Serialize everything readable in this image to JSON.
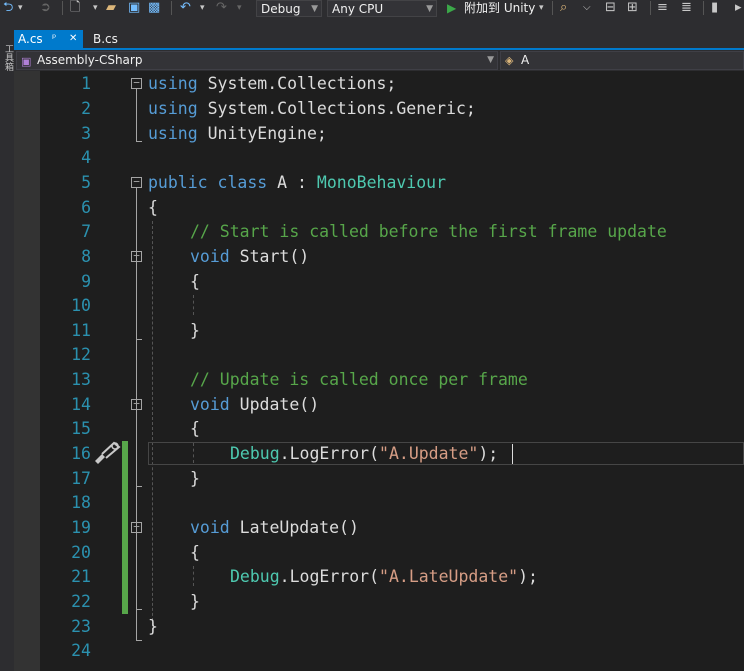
{
  "toolbar": {
    "config": "Debug",
    "platform": "Any CPU",
    "attach_label": "附加到 Unity"
  },
  "side_strip": {
    "label": "工具箱"
  },
  "tabs": [
    {
      "label": "A.cs",
      "pin": "ᵖ",
      "close": "✕"
    },
    {
      "label": "B.cs"
    }
  ],
  "navbar": {
    "project": "Assembly-CSharp",
    "type": "A"
  },
  "colors": {
    "keyword": "#569cd6",
    "type": "#4ec9b0",
    "comment": "#57a64a",
    "string": "#d69d85",
    "line_number": "#2b91af",
    "accent": "#007acc"
  },
  "code": {
    "line_numbers": [
      "1",
      "2",
      "3",
      "4",
      "5",
      "6",
      "7",
      "8",
      "9",
      "10",
      "11",
      "12",
      "13",
      "14",
      "15",
      "16",
      "17",
      "18",
      "19",
      "20",
      "21",
      "22",
      "23",
      "24"
    ],
    "l1": {
      "kw": "using",
      "rest": " System.Collections;"
    },
    "l2": {
      "kw": "using",
      "rest": " System.Collections.Generic;"
    },
    "l3": {
      "kw": "using",
      "rest": " UnityEngine;"
    },
    "l5": {
      "kw1": "public",
      "kw2": " class",
      "name": " A :",
      "base": " MonoBehaviour"
    },
    "l6": "{",
    "l7": "// Start is called before the first frame update",
    "l8": {
      "kw": "void",
      "name": " Start()"
    },
    "l9": "{",
    "l11": "}",
    "l13": "// Update is called once per frame",
    "l14": {
      "kw": "void",
      "name": " Update()"
    },
    "l15": "{",
    "l16": {
      "cls": "Debug",
      "mid": ".LogError(",
      "str": "\"A.Update\"",
      "end": ");"
    },
    "l17": "}",
    "l19": {
      "kw": "void",
      "name": " LateUpdate()"
    },
    "l20": "{",
    "l21": {
      "cls": "Debug",
      "mid": ".LogError(",
      "str": "\"A.LateUpdate\"",
      "end": ");"
    },
    "l22": "}",
    "l23": "}"
  }
}
